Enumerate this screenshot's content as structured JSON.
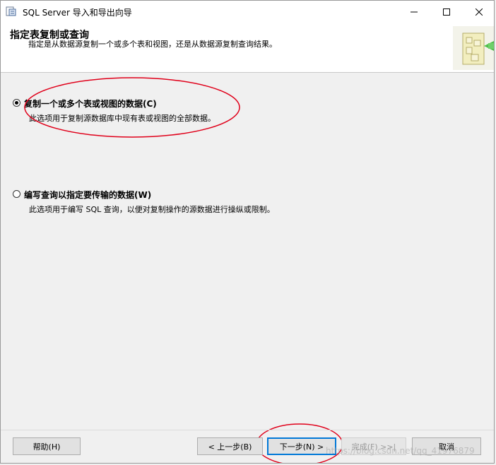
{
  "window": {
    "title": "SQL Server 导入和导出向导"
  },
  "header": {
    "title": "指定表复制或查询",
    "description": "指定是从数据源复制一个或多个表和视图，还是从数据源复制查询结果。"
  },
  "options": [
    {
      "label": "复制一个或多个表或视图的数据(C)",
      "description": "此选项用于复制源数据库中现有表或视图的全部数据。",
      "selected": true
    },
    {
      "label": "编写查询以指定要传输的数据(W)",
      "description": "此选项用于编写 SQL 查询，以便对复制操作的源数据进行操纵或限制。",
      "selected": false
    }
  ],
  "buttons": {
    "help": "帮助(H)",
    "back": "< 上一步(B)",
    "next": "下一步(N) >",
    "finish": "完成(F) >>|",
    "cancel": "取消"
  },
  "watermark": "https://blog.csdn.net/qq_41976879",
  "colors": {
    "annotation": "#e0001a",
    "default_button_border": "#0078d7"
  }
}
